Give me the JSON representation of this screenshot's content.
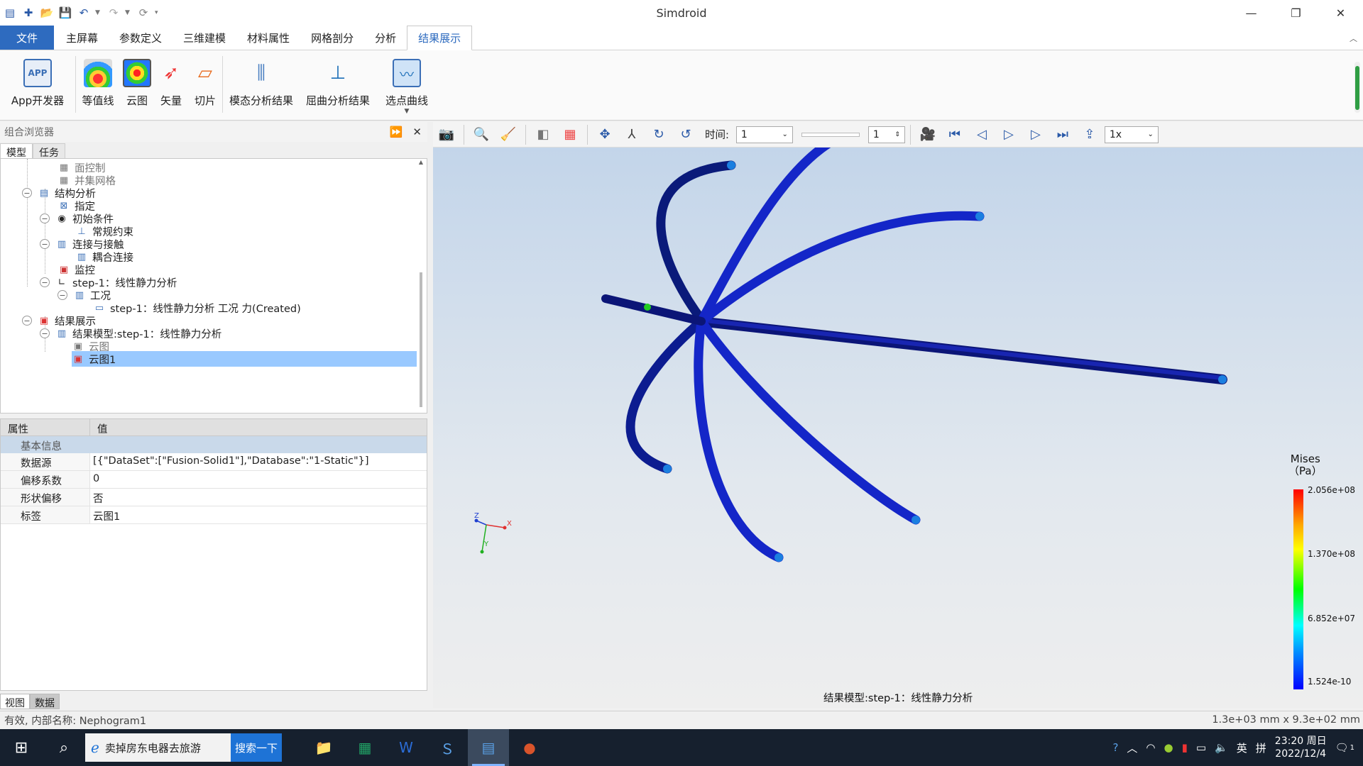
{
  "window": {
    "title": "Simdroid",
    "minimize": "—",
    "restore": "❐",
    "close": "✕"
  },
  "menu": {
    "file": "文件",
    "tabs": [
      "主屏幕",
      "参数定义",
      "三维建模",
      "材料属性",
      "网格剖分",
      "分析",
      "结果展示"
    ],
    "active_tab": "结果展示"
  },
  "ribbon": {
    "app_dev": "App开发器",
    "contour": "等值线",
    "cloud": "云图",
    "vector": "矢量",
    "slice": "切片",
    "modal": "模态分析结果",
    "buckling": "屈曲分析结果",
    "pick_curve": "选点曲线"
  },
  "browser": {
    "title": "组合浏览器",
    "tab_model": "模型",
    "tab_task": "任务",
    "tree": [
      {
        "label": "面控制",
        "grey": true
      },
      {
        "label": "并集网格",
        "grey": true
      },
      {
        "label": "结构分析"
      },
      {
        "label": "指定"
      },
      {
        "label": "初始条件"
      },
      {
        "label": "常规约束"
      },
      {
        "label": "连接与接触"
      },
      {
        "label": "耦合连接"
      },
      {
        "label": "监控"
      },
      {
        "label": "step-1：线性静力分析"
      },
      {
        "label": "工况"
      },
      {
        "label": "step-1：线性静力分析 工况 力(Created)"
      },
      {
        "label": "结果展示"
      },
      {
        "label": "结果模型:step-1：线性静力分析"
      },
      {
        "label": "云图",
        "grey": true
      },
      {
        "label": "云图1",
        "selected": true
      }
    ]
  },
  "properties": {
    "col_prop": "属性",
    "col_value": "值",
    "group": "基本信息",
    "rows": [
      {
        "key": "数据源",
        "value": "[{\"DataSet\":[\"Fusion-Solid1\"],\"Database\":\"1-Static\"}]"
      },
      {
        "key": "偏移系数",
        "value": "0"
      },
      {
        "key": "形状偏移",
        "value": "否"
      },
      {
        "key": "标签",
        "value": "云图1"
      }
    ]
  },
  "bottom_tabs": [
    "视图",
    "数据"
  ],
  "viewer_toolbar": {
    "time_label": "时间:",
    "time_value": "1",
    "frame_value": "1",
    "speed": "1x"
  },
  "viewport": {
    "legend_title_1": "Mises",
    "legend_title_2": "（Pa）",
    "legend_labels": [
      "2.056e+08",
      "1.370e+08",
      "6.852e+07",
      "1.524e-10"
    ],
    "caption": "结果模型:step-1：线性静力分析",
    "axis_z": "Z",
    "axis_x": "X",
    "axis_y": "Y"
  },
  "status": {
    "left": "有效, 内部名称: Nephogram1",
    "right": "1.3e+03 mm x 9.3e+02 mm"
  },
  "taskbar": {
    "search_text": "卖掉房东电器去旅游",
    "search_button": "搜索一下",
    "ime": "英",
    "ime2": "拼",
    "time": "23:20 周日",
    "date": "2022/12/4",
    "notification_count": "1"
  }
}
